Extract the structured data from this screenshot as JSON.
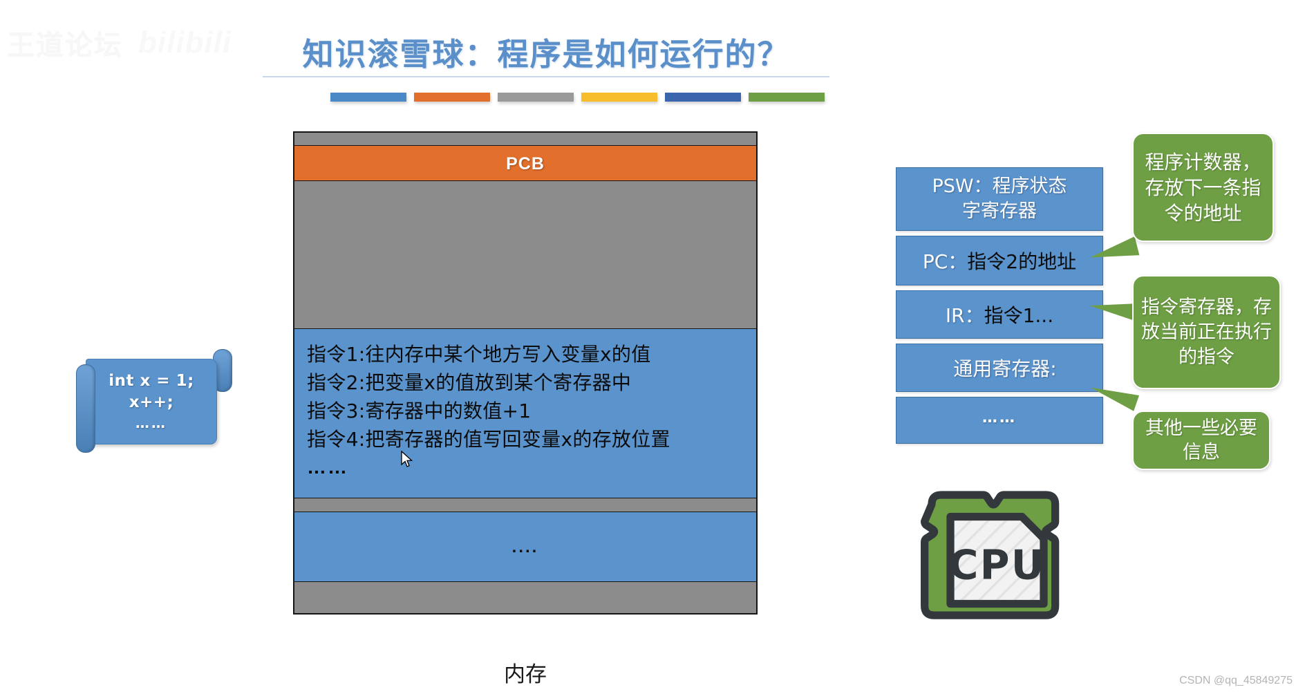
{
  "watermark": {
    "text": "王道论坛",
    "logo": "bilibili"
  },
  "title": {
    "text": "知识滚雪球：程序是如何运行的？",
    "color": "#5b8fc9"
  },
  "color_bars": [
    {
      "name": "bar-blue",
      "color": "#4a89c6"
    },
    {
      "name": "bar-orange",
      "color": "#e2702c"
    },
    {
      "name": "bar-gray",
      "color": "#9a9a9a"
    },
    {
      "name": "bar-yellow",
      "color": "#f7bd2b"
    },
    {
      "name": "bar-darkblue",
      "color": "#3a66ae"
    },
    {
      "name": "bar-green",
      "color": "#6e9f44"
    }
  ],
  "memory": {
    "caption": "内存",
    "pcb_label": "PCB",
    "instructions": [
      "指令1:往内存中某个地方写入变量x的值",
      "指令2:把变量x的值放到某个寄存器中",
      "指令3:寄存器中的数值+1",
      "指令4:把寄存器的值写回变量x的存放位置"
    ],
    "instructions_more": "……",
    "lower_dots": "...."
  },
  "code_scroll": {
    "lines": [
      "int x = 1;",
      "x++;",
      "……"
    ]
  },
  "registers": [
    {
      "name": "psw",
      "key": "PSW：",
      "value": "程序状态",
      "value2": "字寄存器"
    },
    {
      "name": "pc",
      "key": "PC：",
      "value": "指令2的地址"
    },
    {
      "name": "ir",
      "key": "IR：",
      "value": "指令1..."
    },
    {
      "name": "general",
      "key": "通用寄存器:",
      "value": ""
    },
    {
      "name": "etc",
      "key": "……",
      "value": ""
    }
  ],
  "callouts": [
    {
      "name": "pc-callout",
      "text": "程序计数器，存放下一条指令的地址"
    },
    {
      "name": "ir-callout",
      "text": "指令寄存器，存放当前正在执行的指令"
    },
    {
      "name": "etc-callout",
      "text": "其他一些必要信息"
    }
  ],
  "cpu": {
    "label": "CPU"
  },
  "credit": "CSDN @qq_45849275"
}
